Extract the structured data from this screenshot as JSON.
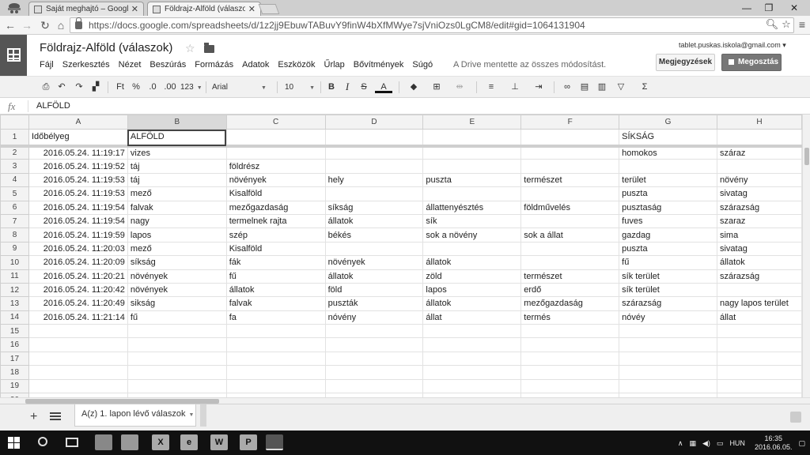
{
  "browser": {
    "tabs": [
      {
        "title": "Saját meghajtó – Google"
      },
      {
        "title": "Földrajz-Alföld (válaszok)"
      }
    ],
    "url": "https://docs.google.com/spreadsheets/d/1z2jj9EbuwTABuvY9finW4bXfMWye7sjVniOzs0LgCM8/edit#gid=1064131904",
    "window_controls": [
      "—",
      "❐",
      "✕"
    ]
  },
  "doc": {
    "title": "Földrajz-Alföld (válaszok)",
    "menu": [
      "Fájl",
      "Szerkesztés",
      "Nézet",
      "Beszúrás",
      "Formázás",
      "Adatok",
      "Eszközök",
      "Űrlap",
      "Bővítmények",
      "Súgó"
    ],
    "save_status": "A Drive mentette az összes módosítást.",
    "account": "tablet.puskas.iskola@gmail.com",
    "comments_label": "Megjegyzések",
    "share_label": "Megosztás"
  },
  "toolbar": {
    "currency": "Ft",
    "percent": "%",
    "dec_dec": ".0",
    "dec_inc": ".00",
    "format_more": "123",
    "font": "Arial",
    "font_size": "10",
    "bold": "B",
    "italic": "I",
    "strike": "S",
    "text_color": "A",
    "sum": "Σ"
  },
  "formula_bar": {
    "fx": "fx",
    "value": "ALFÖLD"
  },
  "sheet": {
    "columns": [
      "A",
      "B",
      "C",
      "D",
      "E",
      "F",
      "G",
      "H"
    ],
    "row_numbers": [
      "1",
      "2",
      "3",
      "4",
      "5",
      "6",
      "7",
      "8",
      "9",
      "10",
      "11",
      "12",
      "13",
      "14",
      "15",
      "16",
      "17",
      "18",
      "19",
      "20"
    ],
    "rows": [
      [
        "Időbélyeg",
        "ALFÖLD",
        "",
        "",
        "",
        "",
        "SÍKSÁG",
        ""
      ],
      [
        "2016.05.24. 11:19:17",
        "vizes",
        "",
        "",
        "",
        "",
        "homokos",
        "száraz"
      ],
      [
        "2016.05.24. 11:19:52",
        "táj",
        "földrész",
        "",
        "",
        "",
        "",
        ""
      ],
      [
        "2016.05.24. 11:19:53",
        "táj",
        "növények",
        "hely",
        "puszta",
        "természet",
        "terület",
        "növény"
      ],
      [
        "2016.05.24. 11:19:53",
        "mező",
        "Kisalföld",
        "",
        "",
        "",
        "puszta",
        "sivatag"
      ],
      [
        "2016.05.24. 11:19:54",
        "falvak",
        "mezőgazdaság",
        "síkság",
        "állattenyésztés",
        "földművelés",
        "pusztaság",
        "szárazság"
      ],
      [
        "2016.05.24. 11:19:54",
        "nagy",
        "termelnek rajta",
        "állatok",
        "sík",
        "",
        "fuves",
        "szaraz"
      ],
      [
        "2016.05.24. 11:19:59",
        "lapos",
        "szép",
        "békés",
        "sok a növény",
        "sok a állat",
        "gazdag",
        "sima"
      ],
      [
        "2016.05.24. 11:20:03",
        "mező",
        "Kisalföld",
        "",
        "",
        "",
        "puszta",
        "sivatag"
      ],
      [
        "2016.05.24. 11:20:09",
        "síkság",
        "fák",
        "növények",
        "állatok",
        "",
        "fű",
        "állatok"
      ],
      [
        "2016.05.24. 11:20:21",
        "növények",
        "fű",
        "állatok",
        "zöld",
        "természet",
        "sík terület",
        "szárazság"
      ],
      [
        "2016.05.24. 11:20:42",
        "növények",
        "állatok",
        "föld",
        "lapos",
        "erdő",
        "sík terület",
        ""
      ],
      [
        "2016.05.24. 11:20:49",
        "sikság",
        "falvak",
        "puszták",
        "állatok",
        "mezőgazdaság",
        "szárazság",
        "nagy lapos terület"
      ],
      [
        "2016.05.24. 11:21:14",
        "fű",
        "fa",
        "nóvény",
        "állat",
        "termés",
        "nóvéy",
        "állat"
      ],
      [
        "",
        "",
        "",
        "",
        "",
        "",
        "",
        ""
      ],
      [
        "",
        "",
        "",
        "",
        "",
        "",
        "",
        ""
      ],
      [
        "",
        "",
        "",
        "",
        "",
        "",
        "",
        ""
      ],
      [
        "",
        "",
        "",
        "",
        "",
        "",
        "",
        ""
      ],
      [
        "",
        "",
        "",
        "",
        "",
        "",
        "",
        ""
      ],
      [
        "",
        "",
        "",
        "",
        "",
        "",
        "",
        ""
      ]
    ],
    "tab_label": "A(z) 1. lapon lévő válaszok"
  },
  "taskbar": {
    "apps": [
      "X",
      "e",
      "W",
      "P"
    ],
    "language": "HUN",
    "time": "16:35",
    "date": "2016.06.05."
  }
}
